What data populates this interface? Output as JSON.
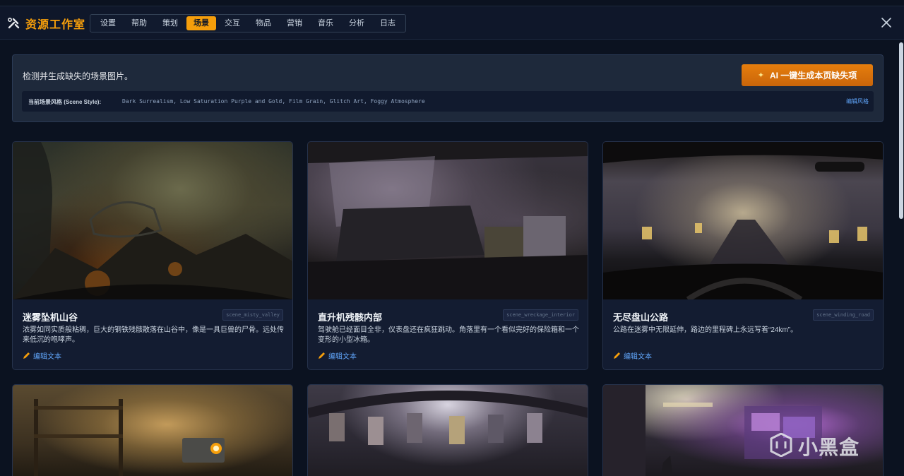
{
  "app": {
    "title": "资源工作室",
    "tabs": [
      {
        "label": "设置",
        "active": false
      },
      {
        "label": "帮助",
        "active": false
      },
      {
        "label": "策划",
        "active": false
      },
      {
        "label": "场景",
        "active": true
      },
      {
        "label": "交互",
        "active": false
      },
      {
        "label": "物品",
        "active": false
      },
      {
        "label": "营销",
        "active": false
      },
      {
        "label": "音乐",
        "active": false
      },
      {
        "label": "分析",
        "active": false
      },
      {
        "label": "日志",
        "active": false
      }
    ],
    "accent_color": "#f59e0b"
  },
  "info": {
    "description": "检测并生成缺失的场景图片。",
    "ai_button": "AI 一键生成本页缺失项",
    "style_label": "当前场景风格 (Scene Style):",
    "style_value": "Dark Surrealism, Low Saturation Purple and Gold, Film Grain, Glitch Art, Foggy Atmosphere",
    "edit_style": "编辑风格"
  },
  "cards": [
    {
      "title": "迷雾坠机山谷",
      "code": "scene_misty_valley",
      "desc": "浓雾如同实质般粘稠，巨大的钢铁残骸散落在山谷中，像是一具巨兽的尸骨。远处传来低沉的咆哮声。",
      "edit": "编辑文本"
    },
    {
      "title": "直升机残骸内部",
      "code": "scene_wreckage_interior",
      "desc": "驾驶舱已经面目全非，仪表盘还在疯狂跳动。角落里有一个看似完好的保险箱和一个变形的小型冰箱。",
      "edit": "编辑文本"
    },
    {
      "title": "无尽盘山公路",
      "code": "scene_winding_road",
      "desc": "公路在迷雾中无限延伸，路边的里程碑上永远写着“24km”。",
      "edit": "编辑文本"
    }
  ],
  "watermark": "小黑盒"
}
